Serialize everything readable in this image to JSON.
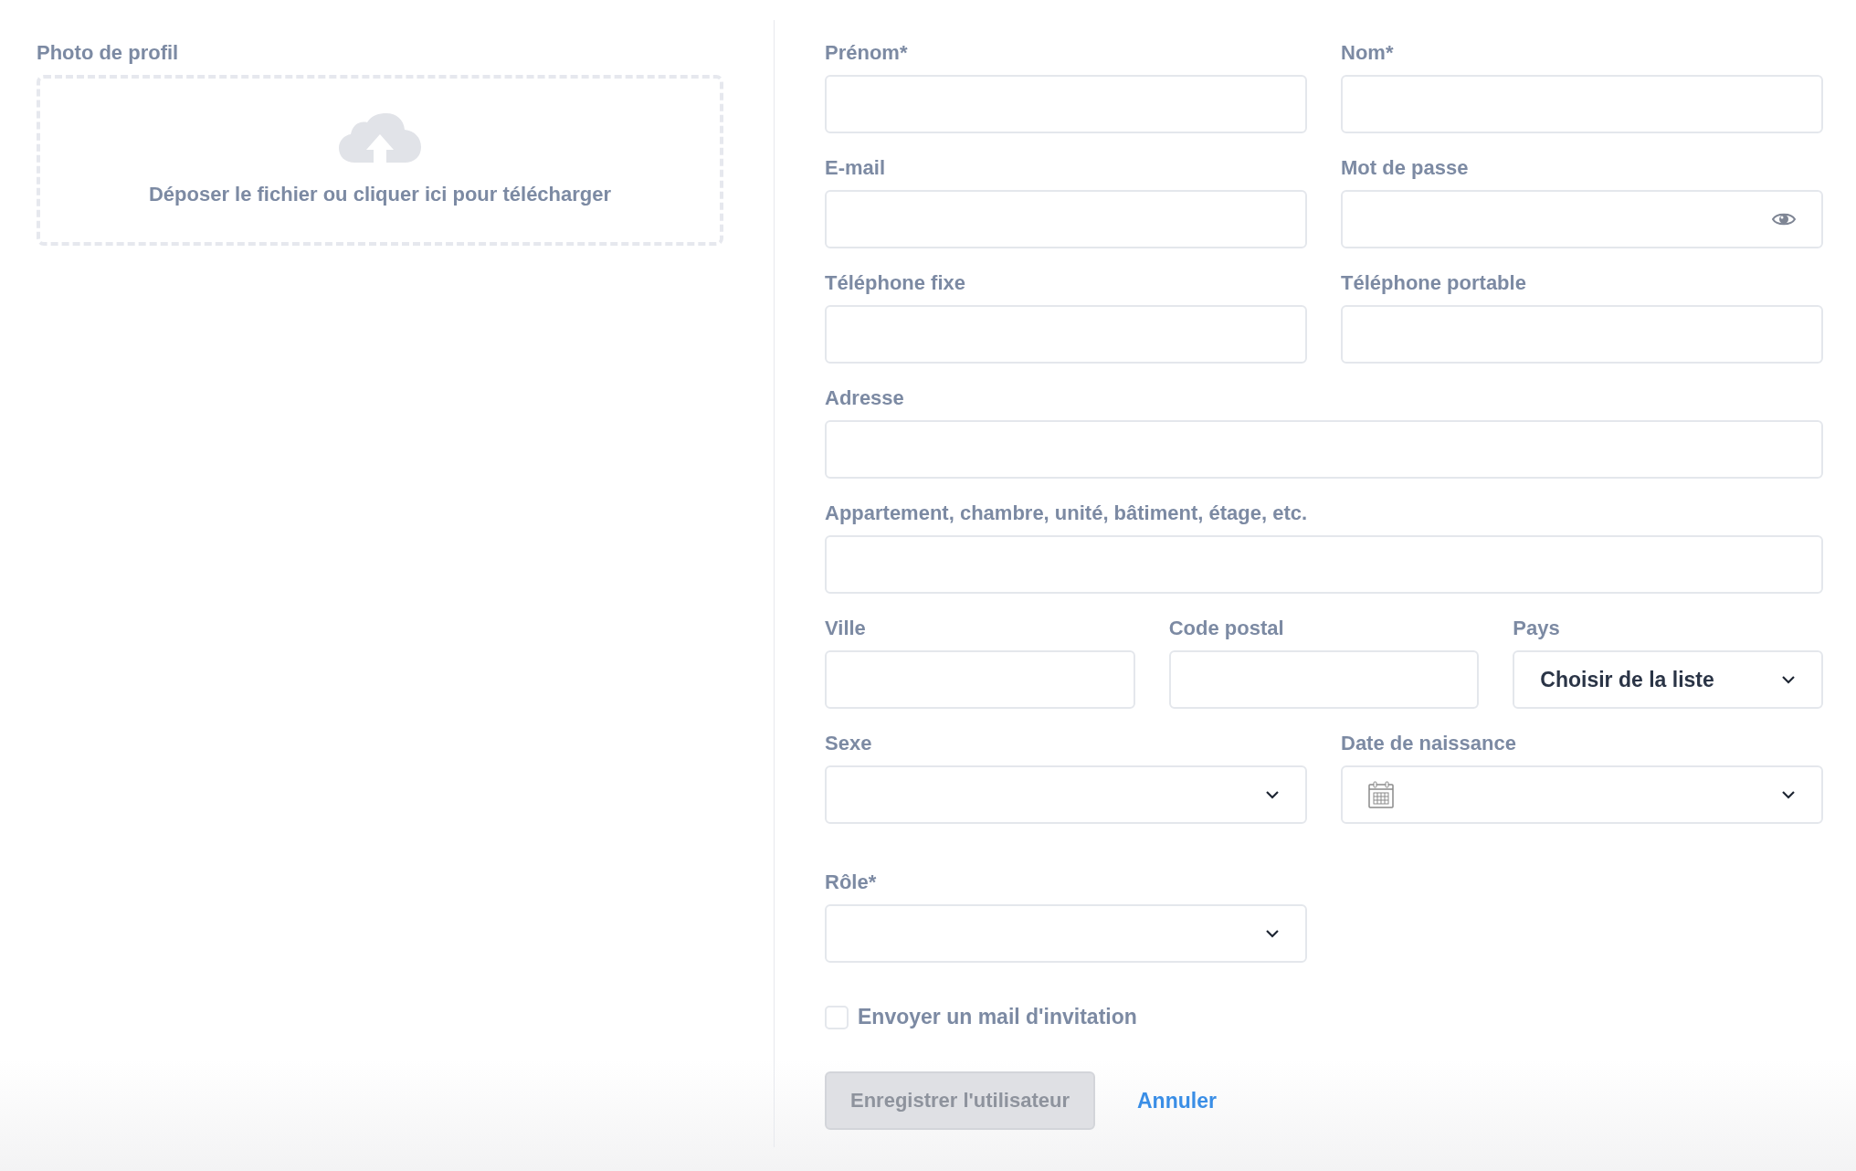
{
  "photo": {
    "label": "Photo de profil",
    "dropzone_text": "Déposer le fichier ou cliquer ici pour télécharger"
  },
  "rows": [
    {
      "fields": [
        {
          "kind": "text",
          "label": "Prénom*"
        },
        {
          "kind": "text",
          "label": "Nom*"
        }
      ]
    },
    {
      "fields": [
        {
          "kind": "text",
          "label": "E-mail"
        },
        {
          "kind": "password",
          "label": "Mot de passe"
        }
      ]
    },
    {
      "fields": [
        {
          "kind": "text",
          "label": "Téléphone fixe"
        },
        {
          "kind": "text",
          "label": "Téléphone portable"
        }
      ]
    },
    {
      "fields": [
        {
          "kind": "text",
          "label": "Adresse"
        }
      ]
    },
    {
      "fields": [
        {
          "kind": "text",
          "label": "Appartement, chambre, unité, bâtiment, étage, etc."
        }
      ]
    },
    {
      "fields": [
        {
          "kind": "text",
          "label": "Ville"
        },
        {
          "kind": "text",
          "label": "Code postal"
        },
        {
          "kind": "select",
          "label": "Pays",
          "value": "Choisir de la liste"
        }
      ]
    },
    {
      "fields": [
        {
          "kind": "select",
          "label": "Sexe"
        },
        {
          "kind": "date",
          "label": "Date de naissance"
        }
      ]
    },
    {
      "fields": [
        {
          "kind": "select",
          "label": "Rôle*"
        }
      ]
    }
  ],
  "invite": {
    "label": "Envoyer un mail d'invitation",
    "checked": false
  },
  "save": {
    "label": "Enregistrer l'utilisateur",
    "disabled": true
  },
  "cancel": {
    "label": "Annuler"
  }
}
